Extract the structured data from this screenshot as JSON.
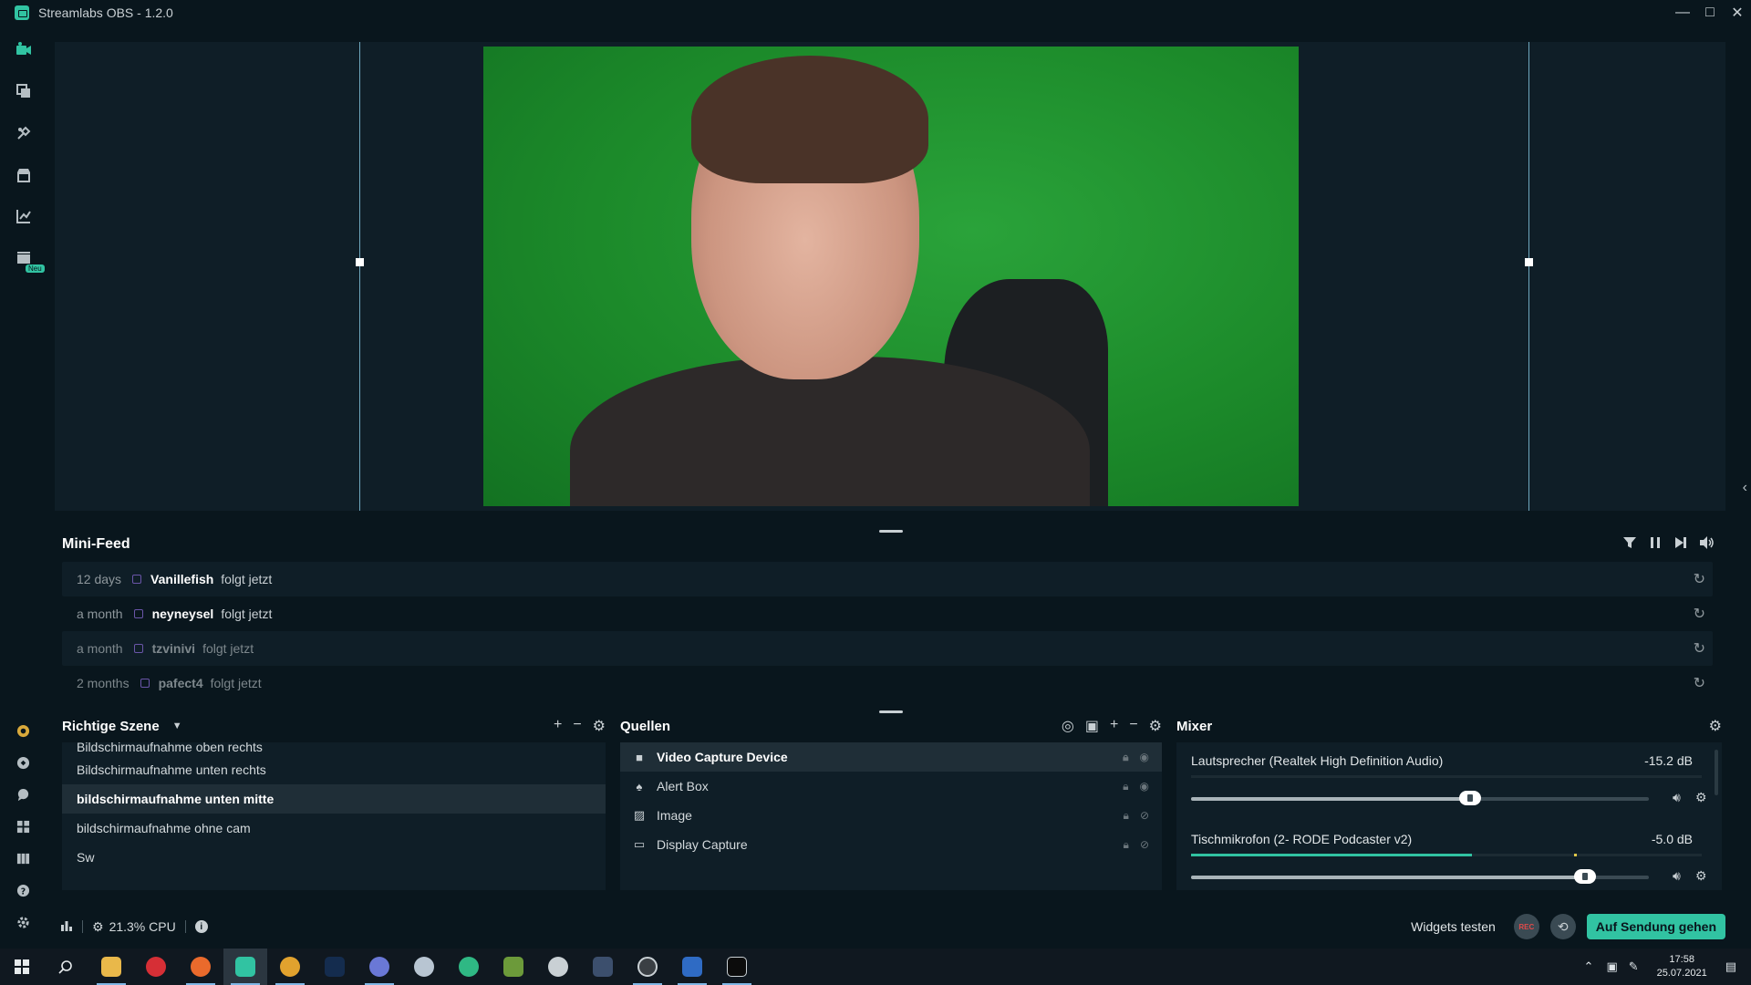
{
  "window": {
    "title": "Streamlabs OBS - 1.2.0",
    "controls": [
      "—",
      "□",
      "✕"
    ]
  },
  "sidebar": {
    "top_icons": [
      "editor-icon",
      "themes-icon",
      "app-store-icon",
      "store-icon",
      "dashboard-icon",
      "highlighter-icon"
    ],
    "new_badge": "Neu",
    "bottom_icons": [
      "prime-icon",
      "cloudbot-icon",
      "chat-icon",
      "layout-icon",
      "studio-mode-icon",
      "help-icon",
      "settings-icon"
    ]
  },
  "minifeed": {
    "title": "Mini-Feed",
    "items": [
      {
        "time": "12 days",
        "user": "Vanillefish",
        "action": "folgt jetzt"
      },
      {
        "time": "a month",
        "user": "neyneysel",
        "action": "folgt jetzt"
      },
      {
        "time": "a month",
        "user": "tzvinivi",
        "action": "folgt jetzt"
      },
      {
        "time": "2 months",
        "user": "pafect4",
        "action": "folgt jetzt"
      }
    ]
  },
  "scenes": {
    "title": "Richtige Szene",
    "items": [
      "Bildschirmaufnahme oben rechts",
      "Bildschirmaufnahme unten rechts",
      "bildschirmaufnahme unten mitte",
      "bildschirmaufnahme ohne cam",
      "Sw"
    ],
    "selected_index": 2
  },
  "sources": {
    "title": "Quellen",
    "items": [
      {
        "label": "Video Capture Device",
        "icon": "camera-icon"
      },
      {
        "label": "Alert Box",
        "icon": "bell-icon"
      },
      {
        "label": "Image",
        "icon": "image-icon"
      },
      {
        "label": "Display Capture",
        "icon": "monitor-icon"
      }
    ],
    "selected_index": 0
  },
  "mixer": {
    "title": "Mixer",
    "tracks": [
      {
        "name": "Lautsprecher (Realtek High Definition Audio)",
        "db": "-15.2 dB",
        "level": 0.0,
        "peak": 0.0,
        "volume": 0.61
      },
      {
        "name": "Tischmikrofon (2- RODE Podcaster v2)",
        "db": "-5.0 dB",
        "level": 0.55,
        "peak": 0.75,
        "volume": 0.86
      }
    ]
  },
  "footer": {
    "cpu": "21.3% CPU",
    "widgets_test": "Widgets testen",
    "rec": "REC",
    "go_live": "Auf Sendung gehen"
  },
  "taskbar": {
    "time": "17:58",
    "date": "25.07.2021",
    "apps": [
      "start-icon",
      "search-icon",
      "file-explorer-icon",
      "opera-icon",
      "firefox-icon",
      "streamlabs-icon",
      "chrome-icon",
      "photoshop-icon",
      "discord-icon",
      "steam-icon",
      "spotify-icon",
      "minecraft-icon",
      "rocket-icon",
      "davinci-icon",
      "obs-icon",
      "word-icon",
      "terminal-icon"
    ]
  },
  "colors": {
    "accent": "#31c3a2",
    "background": "#09161d",
    "panel": "#0f1e27"
  }
}
